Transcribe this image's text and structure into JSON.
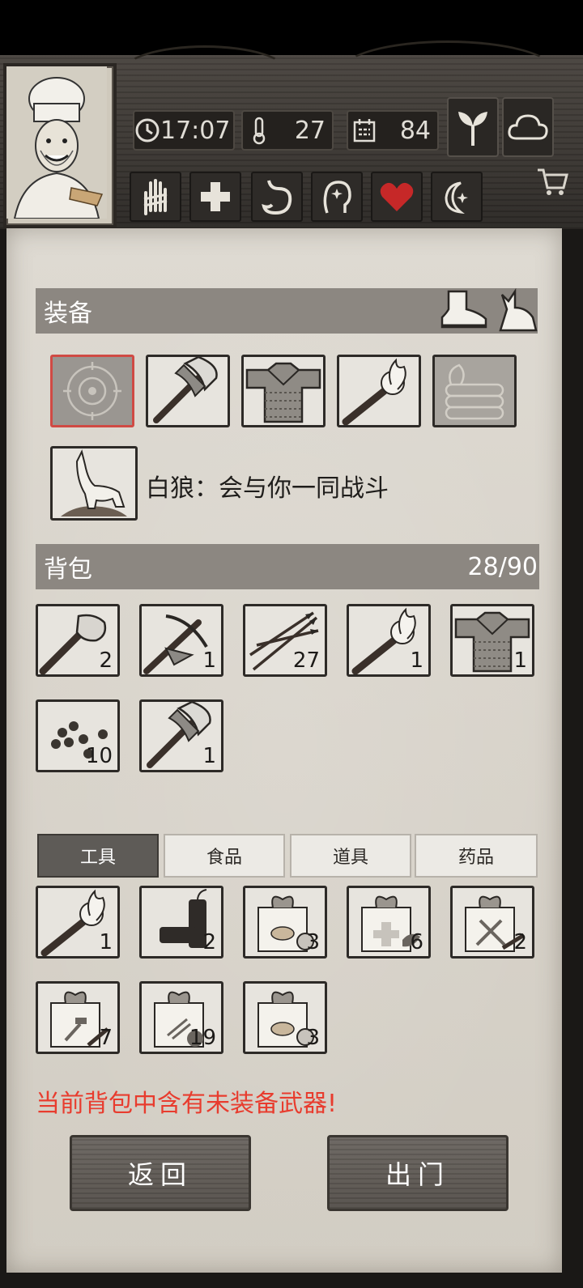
{
  "status": {
    "time": "17:07",
    "temperature": "27",
    "day": "84"
  },
  "equipment": {
    "title": "装备",
    "companion_text": "白狼：会与你一同战斗"
  },
  "backpack": {
    "title": "背包",
    "capacity": "28/90",
    "items": [
      {
        "icon": "stone-axe-icon",
        "count": "2"
      },
      {
        "icon": "crossbow-icon",
        "count": "1"
      },
      {
        "icon": "arrows-icon",
        "count": "27"
      },
      {
        "icon": "torch-icon",
        "count": "1"
      },
      {
        "icon": "chainmail-armor-icon",
        "count": "1"
      },
      {
        "icon": "berries-icon",
        "count": "10"
      },
      {
        "icon": "iron-axe-icon",
        "count": "1"
      }
    ]
  },
  "tabs": [
    "工具",
    "食品",
    "道具",
    "药品"
  ],
  "tools": {
    "items": [
      {
        "icon": "torch-icon",
        "count": "1"
      },
      {
        "icon": "dynamite-icon",
        "count": "2"
      },
      {
        "icon": "food-supply-box-icon",
        "count": "3"
      },
      {
        "icon": "medical-supply-box-icon",
        "count": "6"
      },
      {
        "icon": "weapon-supply-box-icon",
        "count": "2"
      },
      {
        "icon": "tool-supply-box-icon",
        "count": "7"
      },
      {
        "icon": "ammo-supply-box-icon",
        "count": "19"
      },
      {
        "icon": "food-supply-box-icon",
        "count": "3"
      }
    ]
  },
  "warning": "当前背包中含有未装备武器!",
  "buttons": {
    "back": "返回",
    "go_out": "出门"
  },
  "colors": {
    "warning": "#e83c2e",
    "section_header": "#8c8781",
    "active_tab": "#5e5b57",
    "selected_slot_border": "#d04a44"
  }
}
